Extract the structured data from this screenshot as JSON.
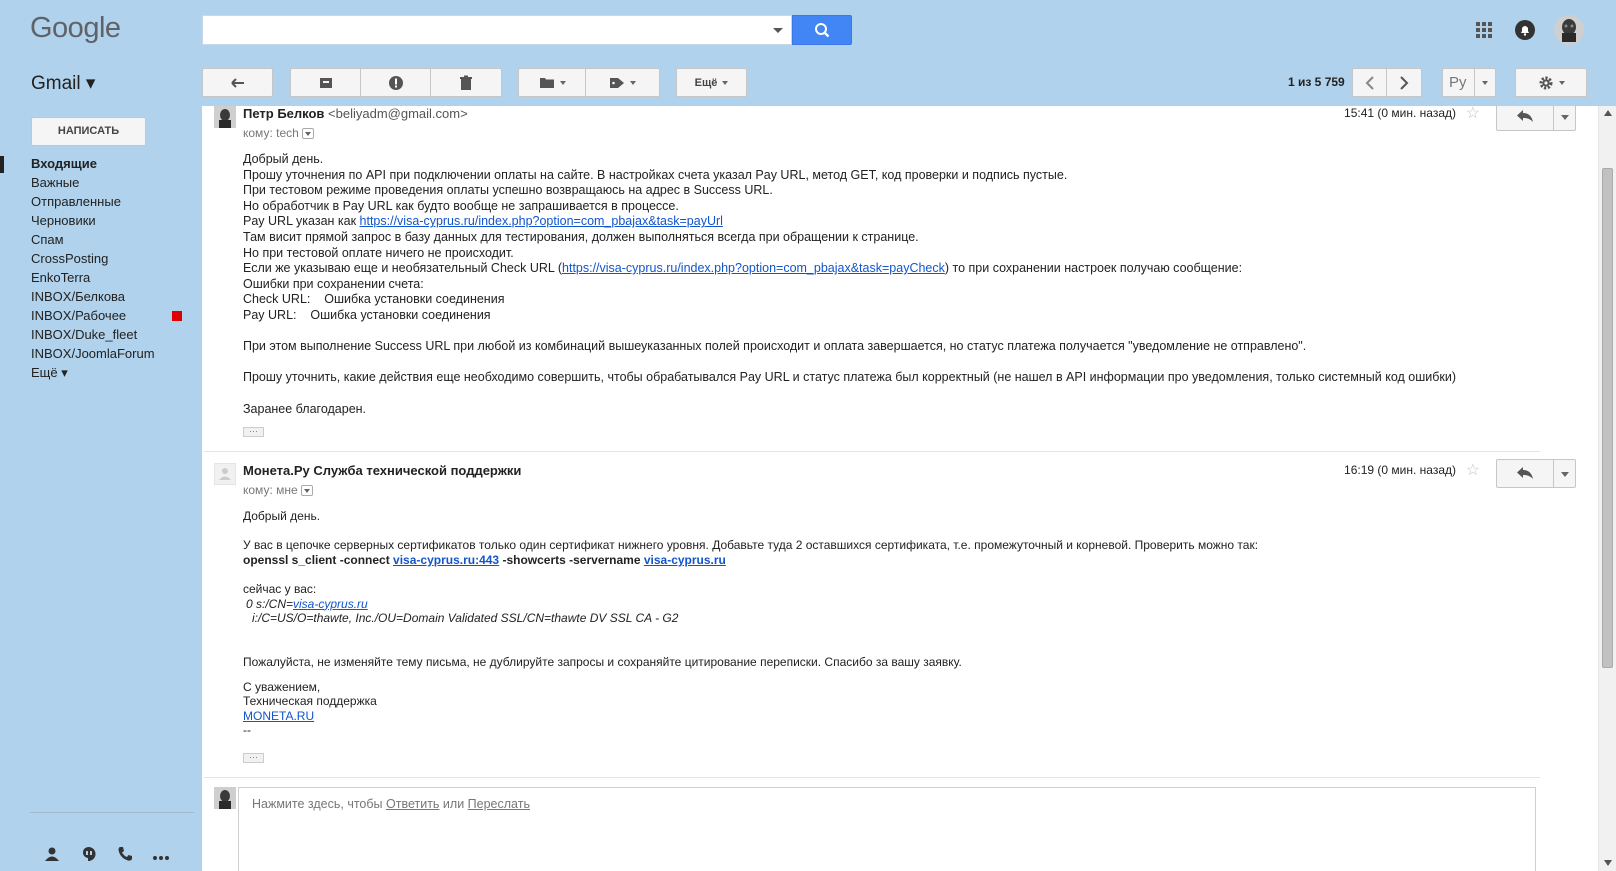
{
  "header": {
    "logo": "Google",
    "search_value": "",
    "apps_icon": "apps-grid-icon",
    "notifications_icon": "bell-icon",
    "account_icon": "avatar"
  },
  "toolbar": {
    "app_label": "Gmail ▾",
    "more_label": "Ещё",
    "pager_text": "1 из 5 759",
    "lang_label": "Ру"
  },
  "sidebar": {
    "compose_label": "НАПИСАТЬ",
    "items": [
      {
        "label": "Входящие"
      },
      {
        "label": "Важные"
      },
      {
        "label": "Отправленные"
      },
      {
        "label": "Черновики"
      },
      {
        "label": "Спам"
      },
      {
        "label": "CrossPosting"
      },
      {
        "label": "EnkoTerra"
      },
      {
        "label": "INBOX/Белкова"
      },
      {
        "label": "INBOX/Рабочее"
      },
      {
        "label": "INBOX/Duke_fleet"
      },
      {
        "label": "INBOX/JoomlaForum"
      },
      {
        "label": "Ещё ▾"
      }
    ],
    "tag_color": "#dd0000"
  },
  "messages": [
    {
      "sender": "Петр Белков",
      "email": "<beliyadm@gmail.com>",
      "to": "кому: tech",
      "time": "15:41 (0 мин. назад)",
      "lines": [
        "Добрый день.",
        "Прошу уточнения по API при подключении оплаты на сайте. В настройках счета указал Pay URL, метод GET, код проверки и подпись пустые.",
        "При тестовом режиме проведения оплаты успешно возвращаюсь на адрес в Success URL.",
        "Но обработчик в Pay URL как будто вообще не запрашивается в процессе.",
        "Pay URL указан как ",
        "Там висит прямой запрос в базу данных для тестирования, должен выполняться всегда при обращении к странице.",
        "Но при тестовой оплате ничего не происходит.",
        "Если же указываю еще и необязательный Check URL (",
        "Ошибки при сохранении счета:",
        "Check URL:    Ошибка установки соединения",
        "Pay URL:    Ошибка установки соединения",
        "При этом выполнение Success URL при любой из комбинаций вышеуказанных полей происходит и оплата завершается, но статус платежа получается \"уведомление не отправлено\".",
        "Прошу уточнить, какие действия еще необходимо совершить, чтобы обрабатывался Pay URL и статус платежа был корректный (не нашел в API информации про уведомления, только системный код ошибки)",
        "Заранее благодарен."
      ],
      "pay_url": "https://visa-cyprus.ru/index.php?option=com_pbajax&task=payUrl",
      "check_url": "https://visa-cyprus.ru/index.php?option=com_pbajax&task=payCheck",
      "check_suffix": ") то при сохранении настроек получаю сообщение:",
      "ellipsis": "···"
    },
    {
      "sender": "Монета.Ру Служба технической поддержки",
      "to": "кому: мне",
      "time": "16:19 (0 мин. назад)",
      "greeting": "Добрый день.",
      "para1": "У вас в цепочке серверных сертификатов только один сертификат нижнего уровня. Добавьте туда 2 оставшихся сертификата, т.е. промежуточный и корневой. Проверить можно так:",
      "cmd_a": "openssl s_client -connect ",
      "cmd_link1": "visa-cyprus.ru:443",
      "cmd_b": " -showcerts -servername ",
      "cmd_link2": "visa-cyprus.ru",
      "now_label": "сейчас у вас:",
      "cert_a": "0 s:/CN=",
      "cert_link": "visa-cyprus.ru",
      "cert_b": "i:/C=US/O=thawte, Inc./OU=Domain Validated SSL/CN=thawte DV SSL CA - G2",
      "para2": "Пожалуйста, не изменяйте тему письма, не дублируйте запросы и сохраняйте цитирование переписки. Спасибо за вашу заявку.",
      "sign1": "С уважением,",
      "sign2": "Техническая поддержка",
      "sign3": "MONETA.RU",
      "sign4": "--",
      "ellipsis": "···"
    }
  ],
  "reply": {
    "prefix": "Нажмите здесь, чтобы ",
    "reply_link": "Ответить",
    "or": " или ",
    "forward_link": "Переслать"
  }
}
